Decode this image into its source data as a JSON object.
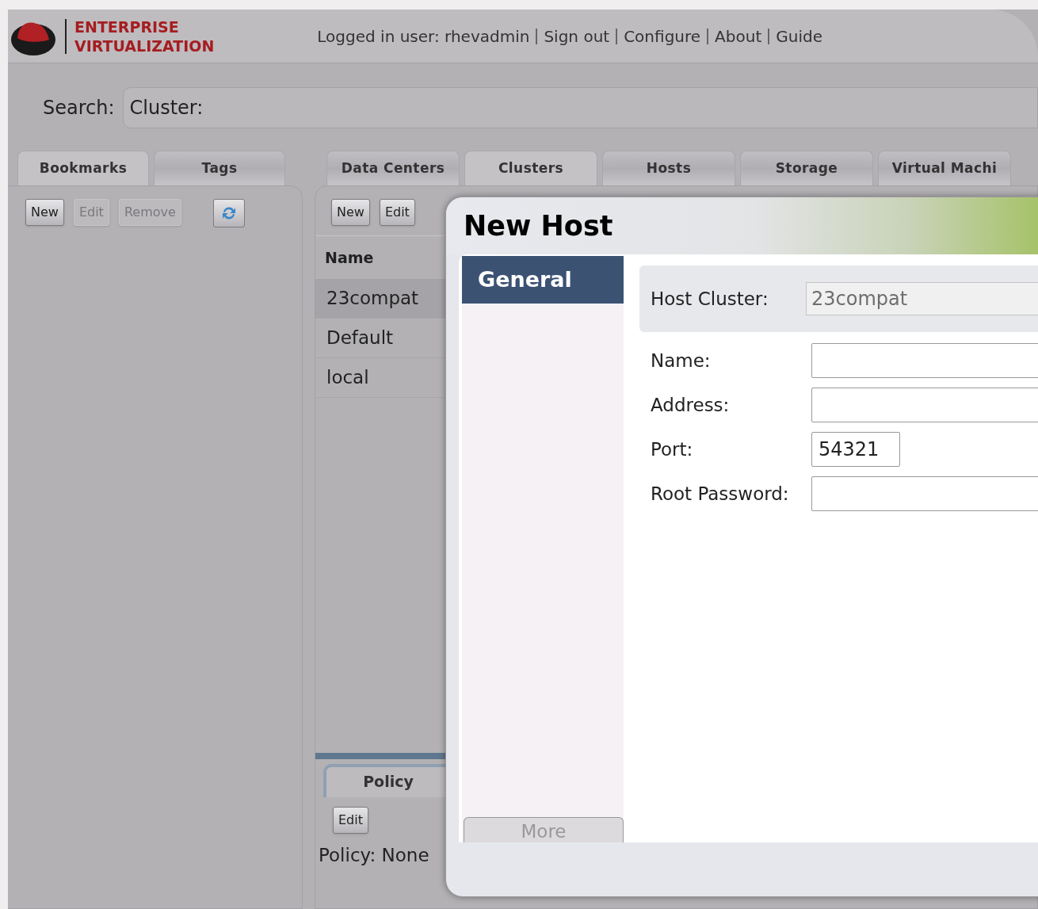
{
  "header": {
    "brand_lines": [
      "ENTERPRISE",
      "VIRTUALIZATION"
    ],
    "links": [
      "Logged in user: rhevadmin",
      "Sign out",
      "Configure",
      "About",
      "Guide"
    ]
  },
  "search": {
    "label": "Search:",
    "value": "Cluster:"
  },
  "left_panel": {
    "tabs": [
      {
        "label": "Bookmarks",
        "selected": true
      },
      {
        "label": "Tags",
        "selected": false
      }
    ],
    "toolbar": [
      {
        "label": "New",
        "disabled": false
      },
      {
        "label": "Edit",
        "disabled": true
      },
      {
        "label": "Remove",
        "disabled": true
      }
    ]
  },
  "main_tabs": [
    {
      "label": "Data Centers",
      "selected": false
    },
    {
      "label": "Clusters",
      "selected": true
    },
    {
      "label": "Hosts",
      "selected": false
    },
    {
      "label": "Storage",
      "selected": false
    },
    {
      "label": "Virtual Machi",
      "selected": false
    }
  ],
  "main_toolbar": [
    {
      "label": "New",
      "disabled": false
    },
    {
      "label": "Edit",
      "disabled": false
    }
  ],
  "table": {
    "columns": [
      "Name"
    ],
    "rows": [
      {
        "name": "23compat",
        "selected": true
      },
      {
        "name": "Default",
        "selected": false
      },
      {
        "name": "local",
        "selected": false
      }
    ]
  },
  "detail": {
    "tabs": [
      {
        "label": "Policy",
        "selected": true
      }
    ],
    "edit_button": "Edit",
    "policy_text": "Policy: None"
  },
  "dialog": {
    "title": "New Host",
    "nav": [
      {
        "label": "General",
        "selected": true
      }
    ],
    "more_button": {
      "label": "More",
      "disabled": true
    },
    "cluster_field": {
      "label": "Host Cluster:",
      "value": "23compat"
    },
    "fields": [
      {
        "label": "Name:"
      },
      {
        "label": "Address:"
      },
      {
        "label": "Port:",
        "value": "54321"
      },
      {
        "label": "Root Password:"
      }
    ]
  }
}
